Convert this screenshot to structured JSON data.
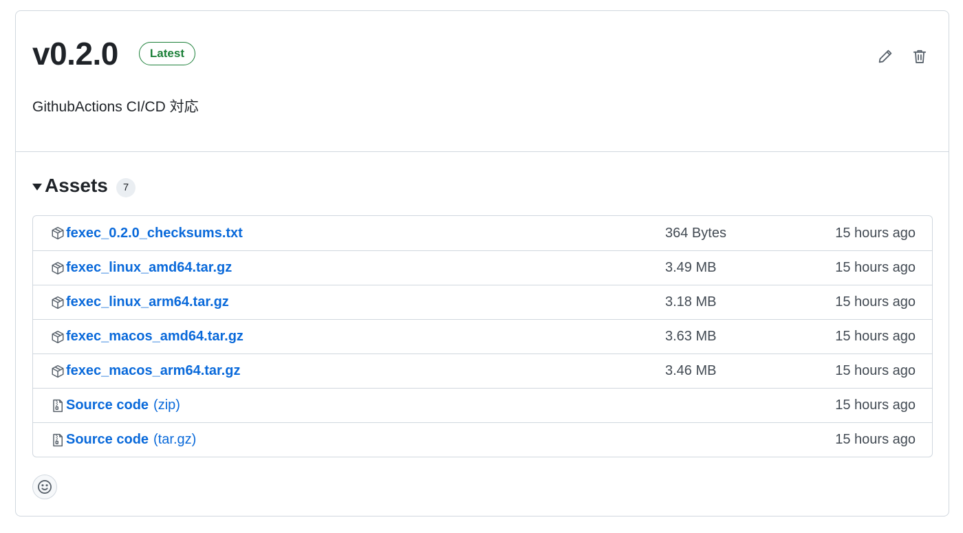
{
  "release": {
    "title": "v0.2.0",
    "badge": "Latest",
    "description": "GithubActions CI/CD 対応"
  },
  "header_actions": {
    "edit_icon": "pencil-icon",
    "delete_icon": "trash-icon"
  },
  "assets": {
    "title": "Assets",
    "count": "7",
    "items": [
      {
        "name": "fexec_0.2.0_checksums.txt",
        "suffix": "",
        "size": "364 Bytes",
        "time": "15 hours ago",
        "icon": "package-icon"
      },
      {
        "name": "fexec_linux_amd64.tar.gz",
        "suffix": "",
        "size": "3.49 MB",
        "time": "15 hours ago",
        "icon": "package-icon"
      },
      {
        "name": "fexec_linux_arm64.tar.gz",
        "suffix": "",
        "size": "3.18 MB",
        "time": "15 hours ago",
        "icon": "package-icon"
      },
      {
        "name": "fexec_macos_amd64.tar.gz",
        "suffix": "",
        "size": "3.63 MB",
        "time": "15 hours ago",
        "icon": "package-icon"
      },
      {
        "name": "fexec_macos_arm64.tar.gz",
        "suffix": "",
        "size": "3.46 MB",
        "time": "15 hours ago",
        "icon": "package-icon"
      },
      {
        "name": "Source code",
        "suffix": "(zip)",
        "size": "",
        "time": "15 hours ago",
        "icon": "file-zip-icon"
      },
      {
        "name": "Source code",
        "suffix": "(tar.gz)",
        "size": "",
        "time": "15 hours ago",
        "icon": "file-zip-icon"
      }
    ]
  },
  "reaction": {
    "icon": "smiley-icon"
  },
  "colors": {
    "link": "#0969da",
    "badge": "#1a7f37",
    "border": "#d0d7de",
    "muted_text": "#424a53"
  }
}
